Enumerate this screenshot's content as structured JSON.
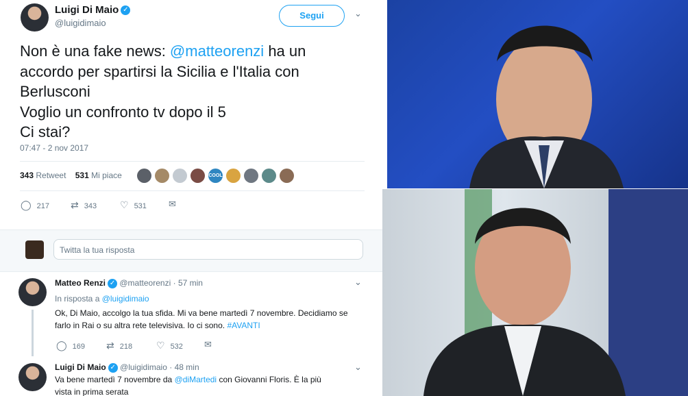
{
  "tweet": {
    "author_name": "Luigi Di Maio",
    "author_handle": "@luigidimaio",
    "follow_label": "Segui",
    "text_line1_prefix": "Non è una fake news: ",
    "text_line1_mention": "@matteorenzi",
    "text_line1_suffix": " ha un",
    "text_line2": "accordo per spartirsi la Sicilia e l'Italia con",
    "text_line3": "Berlusconi",
    "text_line4": "Voglio un confronto tv dopo il 5",
    "text_line5": "Ci stai?",
    "timestamp": "07:47 - 2 nov 2017",
    "retweets_count": "343",
    "retweets_label": "Retweet",
    "likes_count": "531",
    "likes_label": "Mi piace",
    "reply_count": "217",
    "retweet_action_count": "343",
    "like_action_count": "531"
  },
  "reply_box": {
    "placeholder": "Twitta la tua risposta"
  },
  "reply1": {
    "author_name": "Matteo Renzi",
    "author_handle": "@matteorenzi",
    "time": "57 min",
    "in_reply_prefix": "In risposta a ",
    "in_reply_handle": "@luigidimaio",
    "text_line1": "Ok, Di Maio, accolgo la tua sfida. Mi va bene martedì 7 novembre. Decidiamo se",
    "text_line2_prefix": "farlo in Rai o su altra rete televisiva. Io ci sono. ",
    "text_line2_hashtag": "#AVANTI",
    "reply_count": "169",
    "retweet_count": "218",
    "like_count": "532"
  },
  "reply2": {
    "author_name": "Luigi Di Maio",
    "author_handle": "@luigidimaio",
    "time": "48 min",
    "text_line1_prefix": "Va bene martedì 7 novembre da ",
    "text_line1_mention": "@diMartedi",
    "text_line1_suffix": " con Giovanni Floris. È la più",
    "text_line2": "vista in prima serata"
  },
  "glyphs": {
    "verified": "✓",
    "caret": "⌄",
    "more": "⌄",
    "dot": "·",
    "reply_icon": "◯",
    "retweet_icon": "⇄",
    "like_icon": "♡",
    "dm_icon": "✉",
    "cool_badge": "COOL"
  },
  "colors": {
    "accent": "#1da1f2",
    "muted": "#657786",
    "border": "#e6ecf0"
  }
}
